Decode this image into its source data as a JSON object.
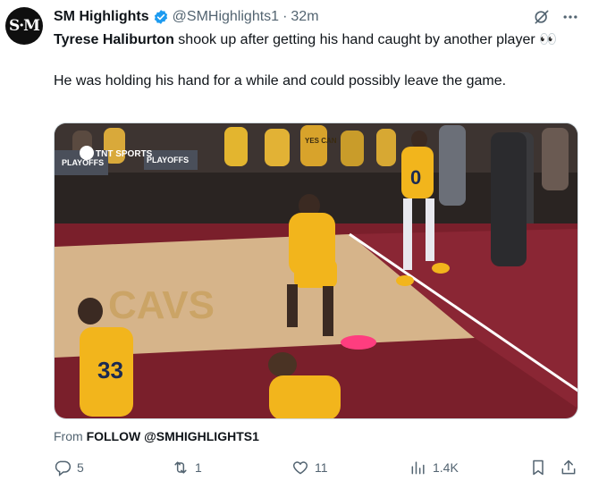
{
  "post": {
    "author": {
      "avatar_text": "S·M",
      "display_name": "SM Highlights",
      "handle": "@SMHighlights1",
      "time": "32m",
      "verified": true
    },
    "text": {
      "name": "Tyrese Haliburton",
      "line1_rest": " shook up after getting his hand caught by another player 👀",
      "line2": "He was holding his hand for a while and could possibly leave the game."
    },
    "media": {
      "type": "video-still",
      "broadcaster_label": "TNT SPORTS",
      "signage": [
        "PLAYOFFS",
        "PLAYOFFS",
        "YES CAN"
      ],
      "jersey_numbers": [
        "0",
        "33"
      ],
      "court_text": "CAVS",
      "colors": {
        "court": "#d6b48a",
        "paint": "#7a1f2b",
        "jersey": "#f2b51c",
        "shoes": "#ff3d7f"
      }
    },
    "from": {
      "prefix": "From ",
      "target": "FOLLOW @SMHIGHLIGHTS1"
    },
    "actions": {
      "replies": "5",
      "reposts": "1",
      "likes": "11",
      "views": "1.4K"
    },
    "colors": {
      "verified": "#1d9bf0",
      "muted": "#536471",
      "text": "#0f1419"
    },
    "icons": [
      "verified-icon",
      "grok-icon",
      "more-icon",
      "reply-icon",
      "repost-icon",
      "like-icon",
      "views-icon",
      "bookmark-icon",
      "share-icon"
    ]
  }
}
